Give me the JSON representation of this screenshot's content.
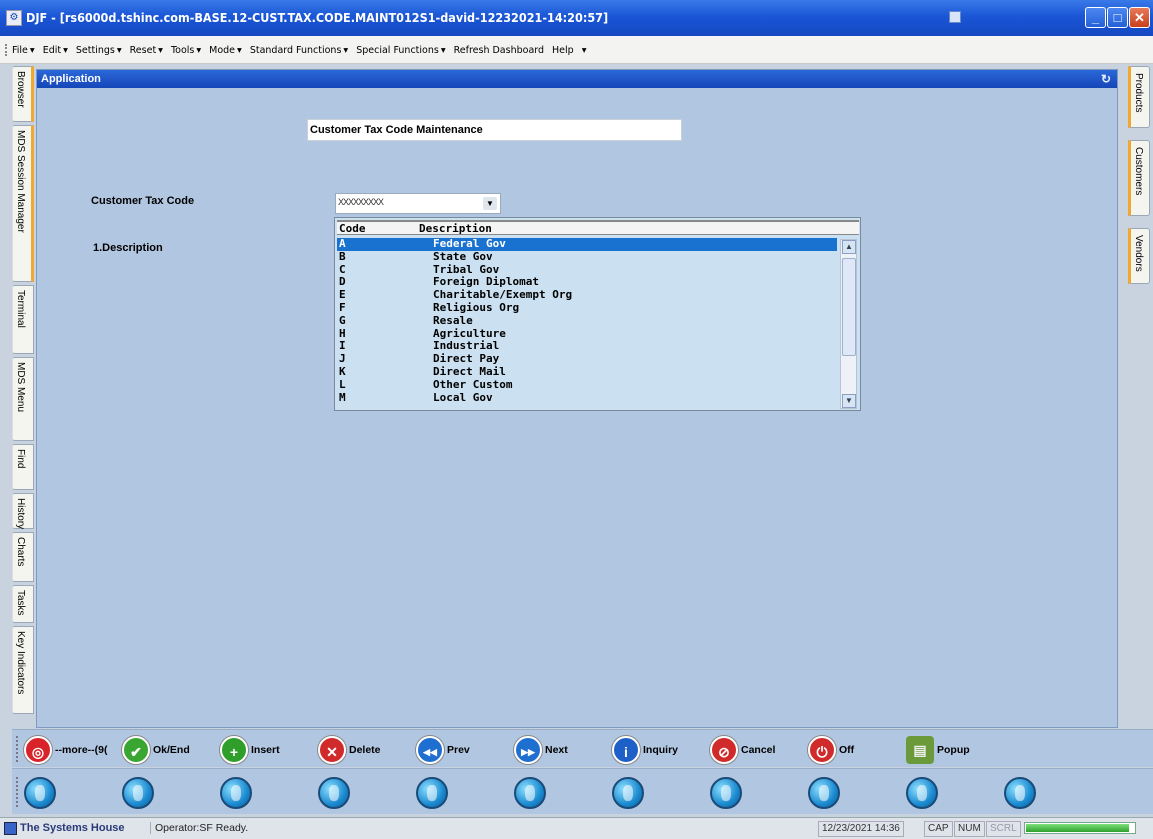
{
  "window": {
    "title": "DJF - [rs6000d.tshinc.com-BASE.12-CUST.TAX.CODE.MAINT012S1-david-12232021-14:20:57]",
    "controls": [
      "minimize",
      "maximize",
      "close"
    ]
  },
  "menu": [
    "File",
    "Edit",
    "Settings",
    "Reset",
    "Tools",
    "Mode",
    "Standard Functions",
    "Special Functions",
    "Refresh Dashboard",
    "Help"
  ],
  "left_tabs": [
    "Browser",
    "MDS Session Manager",
    "Terminal",
    "MDS Menu",
    "Find",
    "History",
    "Charts",
    "Tasks",
    "Key Indicators"
  ],
  "right_tabs": [
    "Products",
    "Customers",
    "Vendors"
  ],
  "panel": {
    "header": "Application",
    "form_title": "Customer Tax Code Maintenance",
    "field_code_label": "Customer Tax Code",
    "field_code_value": "XXXXXXXXX",
    "field_desc_label": "1.Description"
  },
  "lookup": {
    "columns": [
      "Code",
      "Description"
    ],
    "selected_index": 0,
    "rows": [
      {
        "code": "A",
        "description": "Federal Gov"
      },
      {
        "code": "B",
        "description": "State Gov"
      },
      {
        "code": "C",
        "description": "Tribal Gov"
      },
      {
        "code": "D",
        "description": "Foreign Diplomat"
      },
      {
        "code": "E",
        "description": "Charitable/Exempt Org"
      },
      {
        "code": "F",
        "description": "Religious Org"
      },
      {
        "code": "G",
        "description": "Resale"
      },
      {
        "code": "H",
        "description": "Agriculture"
      },
      {
        "code": "I",
        "description": "Industrial"
      },
      {
        "code": "J",
        "description": "Direct Pay"
      },
      {
        "code": "K",
        "description": "Direct Mail"
      },
      {
        "code": "L",
        "description": "Other Custom"
      },
      {
        "code": "M",
        "description": "Local Gov"
      }
    ]
  },
  "function_buttons": [
    {
      "label": "--more--(9(",
      "icon": "lifebuoy-icon",
      "color": "#d8232a"
    },
    {
      "label": "Ok/End",
      "icon": "check-icon",
      "color": "#3aa632"
    },
    {
      "label": "Insert",
      "icon": "plus-icon",
      "color": "#2f9e2a"
    },
    {
      "label": "Delete",
      "icon": "x-icon",
      "color": "#d12a2a"
    },
    {
      "label": "Prev",
      "icon": "rewind-icon",
      "color": "#1f6fd0"
    },
    {
      "label": "Next",
      "icon": "fast-forward-icon",
      "color": "#1f6fd0"
    },
    {
      "label": "Inquiry",
      "icon": "info-icon",
      "color": "#1f5fc8"
    },
    {
      "label": "Cancel",
      "icon": "cancel-icon",
      "color": "#d12a2a"
    },
    {
      "label": "Off",
      "icon": "power-icon",
      "color": "#d12a2a"
    },
    {
      "label": "Popup",
      "icon": "database-add-icon",
      "color": "#6a9a3a"
    }
  ],
  "globe_buttons_count": 11,
  "status": {
    "company": "The Systems House",
    "operator": "Operator:SF Ready.",
    "datetime": "12/23/2021 14:36",
    "cap": "CAP",
    "num": "NUM",
    "scrl": "SCRL",
    "progress_fraction": 0.95
  }
}
